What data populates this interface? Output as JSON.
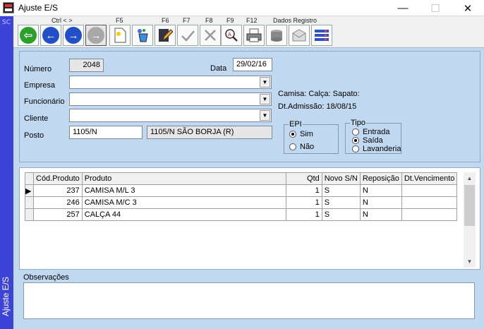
{
  "window": {
    "title": "Ajuste E/S",
    "minimize": "—",
    "maximize": "☐",
    "close": "✕"
  },
  "sidebar": {
    "short": "SC",
    "label": "Ajuste E/S"
  },
  "toolbar": {
    "key_labels": {
      "nav": "Ctrl < >",
      "f5": "F5",
      "f6": "F6",
      "f7": "F7",
      "f8": "F8",
      "f9": "F9",
      "f12": "F12",
      "data": "Dados Registro"
    }
  },
  "form": {
    "numero": {
      "label": "Número",
      "value": "2048"
    },
    "data": {
      "label": "Data",
      "value": "29/02/16"
    },
    "empresa": {
      "label": "Empresa",
      "value": ""
    },
    "funcionario": {
      "label": "Funcionário",
      "value": ""
    },
    "cliente": {
      "label": "Cliente",
      "value": ""
    },
    "posto": {
      "label": "Posto",
      "code": "1105/N",
      "desc": "1105/N SÃO BORJA (R)"
    },
    "info": {
      "sizes": "Camisa:  Calça:  Sapato:",
      "admissao": "Dt.Admissão: 18/08/15"
    },
    "epi": {
      "caption": "EPI",
      "options": [
        "Sim",
        "Não"
      ],
      "selected": "Sim"
    },
    "tipo": {
      "caption": "Tipo",
      "options": [
        "Entrada",
        "Saída",
        "Lavanderia"
      ],
      "selected": "Saída"
    }
  },
  "grid": {
    "headers": [
      "Cód.Produto",
      "Produto",
      "Qtd",
      "Novo S/N",
      "Reposição",
      "Dt.Vencimento"
    ],
    "rows": [
      {
        "codigo": "237",
        "produto": "CAMISA M/L 3",
        "qtd": "1",
        "novo": "S",
        "reposicao": "N",
        "vencimento": ""
      },
      {
        "codigo": "246",
        "produto": "CAMISA M/C 3",
        "qtd": "1",
        "novo": "S",
        "reposicao": "N",
        "vencimento": ""
      },
      {
        "codigo": "257",
        "produto": "CALÇA 44",
        "qtd": "1",
        "novo": "S",
        "reposicao": "N",
        "vencimento": ""
      }
    ]
  },
  "observacoes": {
    "label": "Observações",
    "value": ""
  },
  "colors": {
    "sidebar": "#3c43d6",
    "panel": "#c0d8f0",
    "green_btn": "#2aa02a",
    "blue_btn": "#2350c8"
  }
}
